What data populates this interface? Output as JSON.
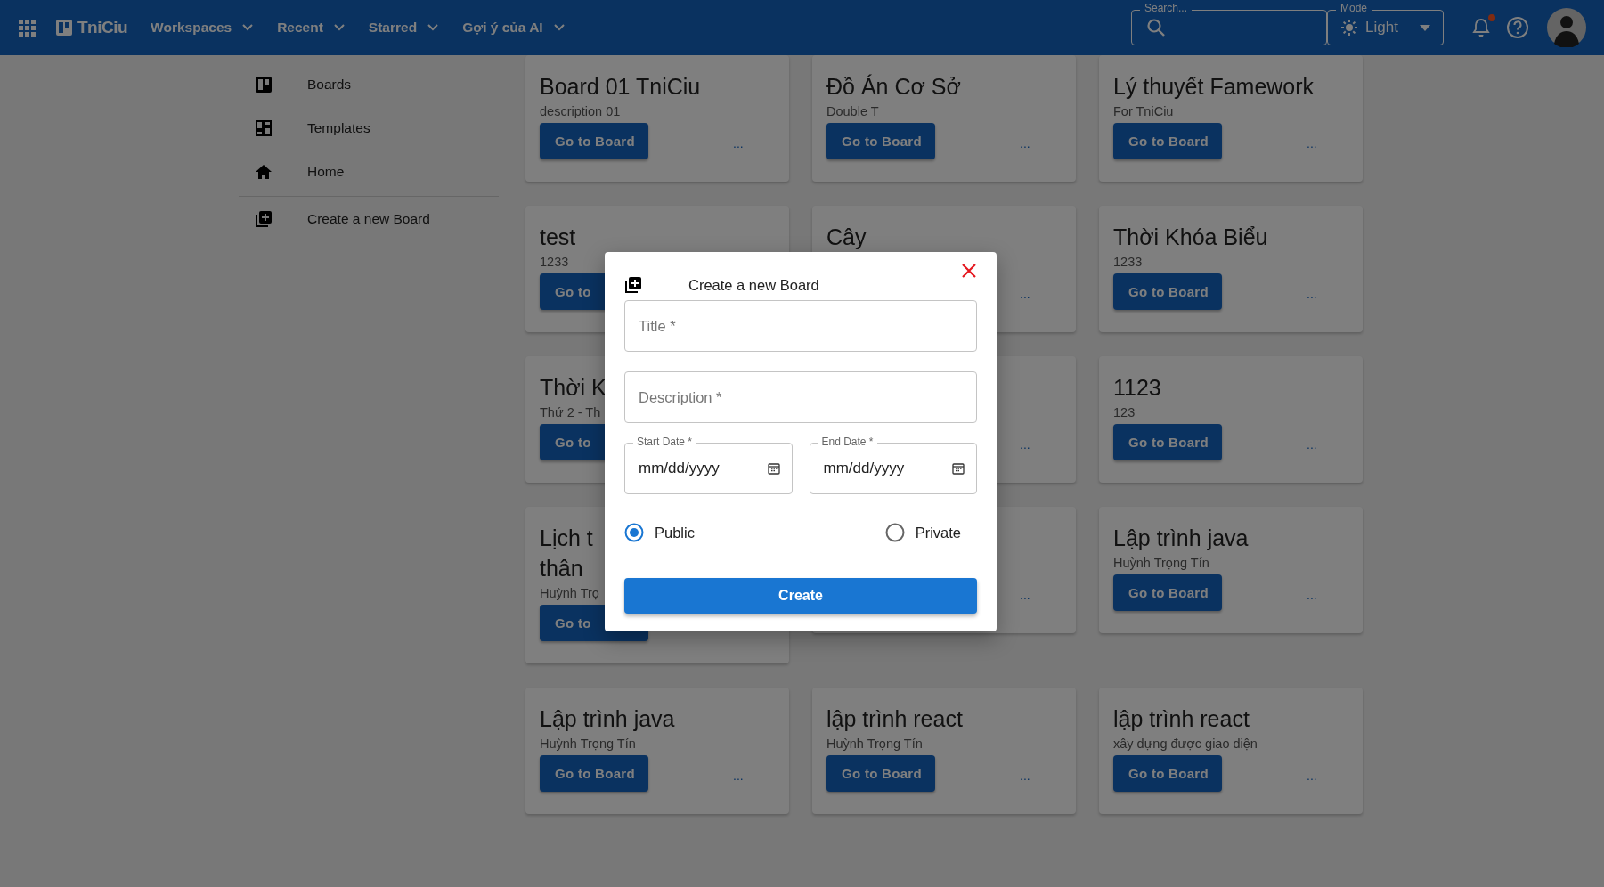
{
  "app_bar": {
    "logo": "TniCiu",
    "menus": [
      {
        "label": "Workspaces"
      },
      {
        "label": "Recent"
      },
      {
        "label": "Starred"
      },
      {
        "label": "Gợi ý của AI"
      }
    ],
    "search": {
      "label": "Search..."
    },
    "mode": {
      "label": "Mode",
      "value": "Light"
    },
    "notifications": {
      "unread": true
    }
  },
  "sidebar": {
    "items": [
      {
        "label": "Boards",
        "kind": "boards"
      },
      {
        "label": "Templates",
        "kind": "templates"
      },
      {
        "label": "Home",
        "kind": "home"
      },
      {
        "label": "Create a new Board",
        "kind": "create"
      }
    ]
  },
  "boards": [
    {
      "title_lines": [
        "Board 01 TniCiu"
      ],
      "description": "description 01",
      "button": "Go to Board",
      "more": "..."
    },
    {
      "title_lines": [
        "Đồ Án Cơ Sở"
      ],
      "description": "Double T",
      "button": "Go to Board",
      "more": "..."
    },
    {
      "title_lines": [
        "Lý thuyết Famework"
      ],
      "description": "For TniCiu",
      "button": "Go to Board",
      "more": "..."
    },
    {
      "title_lines": [
        "test"
      ],
      "description": "1233",
      "button": "Go to"
    },
    {
      "title_lines": [
        "Cây"
      ],
      "more": "..."
    },
    {
      "title_lines": [
        "Thời Khóa Biểu"
      ],
      "description": "1233",
      "button": "Go to Board",
      "more": "..."
    },
    {
      "title_lines": [
        "Thời K"
      ],
      "description": "Thứ 2 - Th",
      "button": "Go to"
    },
    {
      "more": "..."
    },
    {
      "title_lines": [
        "1123"
      ],
      "description": "123",
      "button": "Go to Board",
      "more": "..."
    },
    {
      "title_lines": [
        "Lịch t",
        "thân"
      ],
      "description": "Huỳnh Trọ",
      "button": "Go to"
    },
    {
      "more": "..."
    },
    {
      "title_lines": [
        "Lập trình java"
      ],
      "description": "Huỳnh Trọng Tín",
      "button": "Go to Board",
      "more": "..."
    },
    {
      "title_lines": [
        "Lập trình java"
      ],
      "description": "Huỳnh Trọng Tín",
      "button": "Go to Board",
      "more": "..."
    },
    {
      "title_lines": [
        "lập trình react"
      ],
      "description": "Huỳnh Trọng Tín",
      "button": "Go to Board",
      "more": "..."
    },
    {
      "title_lines": [
        "lập trình react"
      ],
      "description": "xây dựng được giao diện",
      "button": "Go to Board",
      "more": "..."
    }
  ],
  "dialog": {
    "title": "Create a new Board",
    "title_field": {
      "placeholder": "Title *"
    },
    "description_field": {
      "placeholder": "Description *"
    },
    "start_date": {
      "label": "Start Date *",
      "placeholder": "mm/dd/yyyy"
    },
    "end_date": {
      "label": "End Date *",
      "placeholder": "mm/dd/yyyy"
    },
    "visibility": [
      {
        "label": "Public",
        "selected": true
      },
      {
        "label": "Private",
        "selected": false
      }
    ],
    "submit": "Create"
  }
}
